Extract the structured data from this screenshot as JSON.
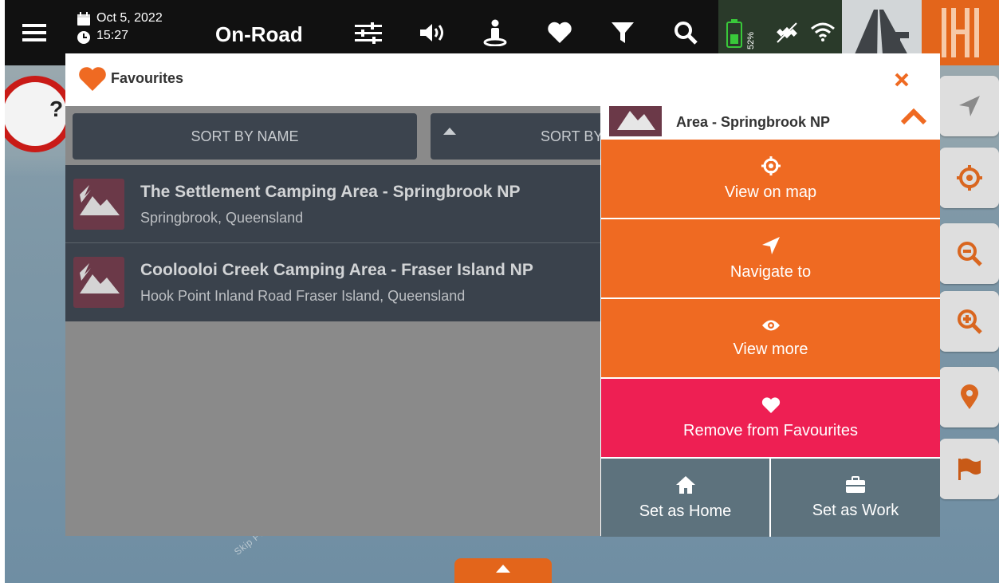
{
  "topbar": {
    "date": "Oct 5, 2022",
    "time": "15:27",
    "mode": "On-Road",
    "battery_pct": "52%",
    "icons": [
      "menu-icon",
      "calendar-icon",
      "clock-icon",
      "sliders-icon",
      "volume-icon",
      "person-icon",
      "heart-icon",
      "filter-icon",
      "search-icon",
      "battery-icon",
      "gps-off-icon",
      "wifi-icon",
      "road-icon",
      "logo-icon"
    ]
  },
  "map": {
    "label": "Skip Point"
  },
  "dialog": {
    "title": "Favourites",
    "sort_name": "SORT BY NAME",
    "sort_other": "SORT BY",
    "items": [
      {
        "name": "The Settlement Camping Area - Springbrook NP",
        "subtitle": "Springbrook, Queensland"
      },
      {
        "name": "Coolooloi Creek Camping Area - Fraser Island NP",
        "subtitle": "Hook Point Inland Road Fraser Island, Queensland"
      }
    ]
  },
  "context": {
    "title": "Area - Springbrook NP",
    "actions": {
      "view_on_map": "View on map",
      "navigate_to": "Navigate to",
      "view_more": "View more",
      "remove_fav": "Remove from Favourites",
      "set_home": "Set as Home",
      "set_work": "Set as Work"
    }
  },
  "colors": {
    "accent": "#ef6a22",
    "danger": "#ee1f53",
    "secondary": "#5d727d",
    "list_bg": "#3a424c"
  }
}
